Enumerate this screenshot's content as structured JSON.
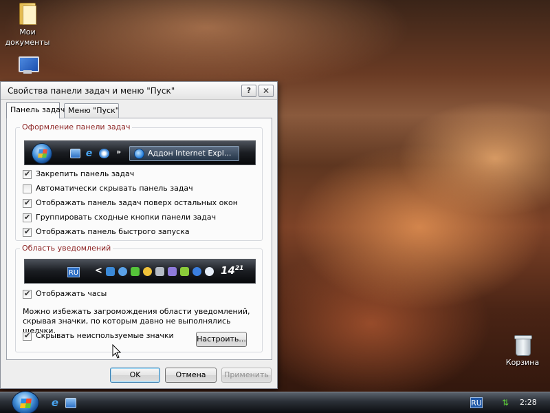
{
  "desktop": {
    "icons": [
      {
        "label": "Мои документы",
        "icon": "folder-icon"
      },
      {
        "label": "",
        "icon": "computer-icon"
      },
      {
        "label": "Корзина",
        "icon": "recycle-bin-icon"
      }
    ]
  },
  "dialog": {
    "title": "Свойства панели задач и меню \"Пуск\"",
    "help_glyph": "?",
    "close_glyph": "✕",
    "tabs": [
      {
        "label": "Панель задач",
        "active": true
      },
      {
        "label": "Меню \"Пуск\"",
        "active": false
      }
    ],
    "taskbar_group": {
      "title": "Оформление панели задач",
      "preview_button": "Аддон Internet Expl...",
      "chevron": "»",
      "options": [
        {
          "label": "Закрепить панель задач",
          "checked": true
        },
        {
          "label": "Автоматически скрывать панель задач",
          "checked": false
        },
        {
          "label": "Отображать панель задач поверх остальных окон",
          "checked": true
        },
        {
          "label": "Группировать сходные кнопки панели задач",
          "checked": true
        },
        {
          "label": "Отображать панель быстрого запуска",
          "checked": true
        }
      ]
    },
    "notification_group": {
      "title": "Область уведомлений",
      "preview_lang": "RU",
      "preview_arrow": "<",
      "preview_clock_hour": "14",
      "preview_clock_min": "21",
      "show_clock": {
        "label": "Отображать часы",
        "checked": true
      },
      "description": "Можно избежать загромождения области уведомлений, скрывая значки, по которым давно не выполнялись щелчки.",
      "hide_icons": {
        "label": "Скрывать неиспользуемые значки",
        "checked": true
      },
      "customize_button": "Настроить..."
    },
    "buttons": {
      "ok": "OK",
      "cancel": "Отмена",
      "apply": "Применить"
    }
  },
  "taskbar": {
    "lang": "RU",
    "clock": "2:28"
  },
  "colors": {
    "group_title": "#8a1f1f",
    "taskbar_dark": "#0c0e11",
    "accent_blue": "#3c7fb1"
  }
}
